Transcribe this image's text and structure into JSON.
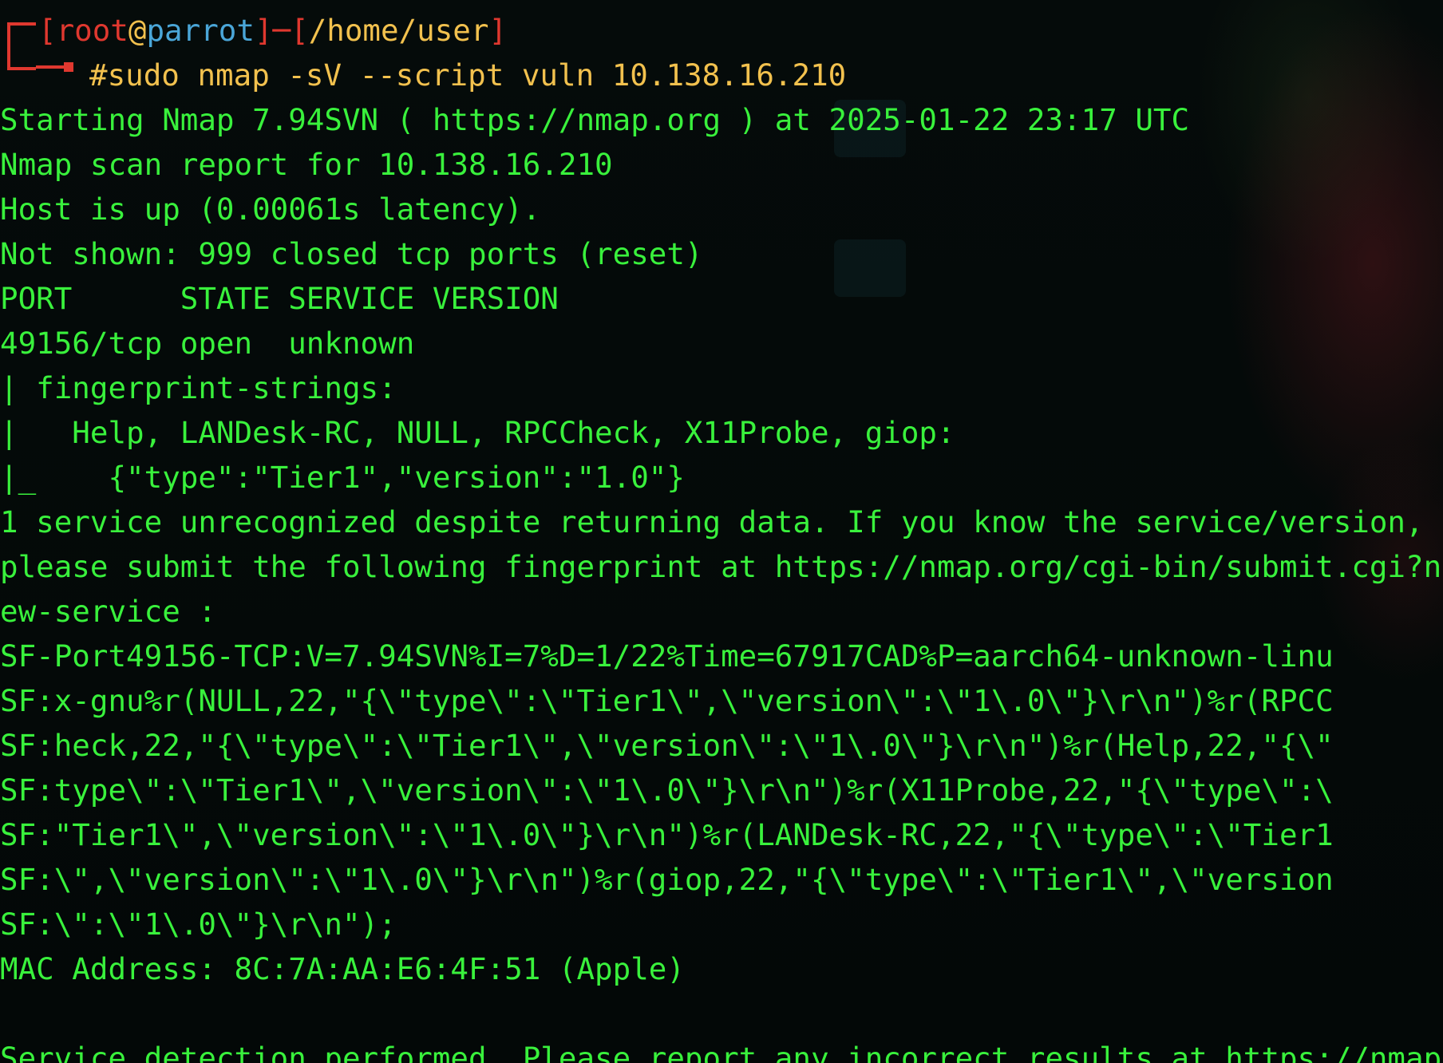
{
  "prompt": {
    "open_bracket": "[",
    "user": "root",
    "at": "@",
    "host": "parrot",
    "separator": "]─[",
    "path": "/home/user",
    "close_bracket": "]",
    "command": "#sudo nmap -sV --script vuln 10.138.16.210"
  },
  "output_lines": [
    "Starting Nmap 7.94SVN ( https://nmap.org ) at 2025-01-22 23:17 UTC",
    "Nmap scan report for 10.138.16.210",
    "Host is up (0.00061s latency).",
    "Not shown: 999 closed tcp ports (reset)",
    "PORT      STATE SERVICE VERSION",
    "49156/tcp open  unknown",
    "| fingerprint-strings:",
    "|   Help, LANDesk-RC, NULL, RPCCheck, X11Probe, giop:",
    "|_    {\"type\":\"Tier1\",\"version\":\"1.0\"}",
    "1 service unrecognized despite returning data. If you know the service/version,",
    "please submit the following fingerprint at https://nmap.org/cgi-bin/submit.cgi?n",
    "ew-service :",
    "SF-Port49156-TCP:V=7.94SVN%I=7%D=1/22%Time=67917CAD%P=aarch64-unknown-linu",
    "SF:x-gnu%r(NULL,22,\"{\\\"type\\\":\\\"Tier1\\\",\\\"version\\\":\\\"1\\.0\\\"}\\r\\n\")%r(RPCC",
    "SF:heck,22,\"{\\\"type\\\":\\\"Tier1\\\",\\\"version\\\":\\\"1\\.0\\\"}\\r\\n\")%r(Help,22,\"{\\\"",
    "SF:type\\\":\\\"Tier1\\\",\\\"version\\\":\\\"1\\.0\\\"}\\r\\n\")%r(X11Probe,22,\"{\\\"type\\\":\\",
    "SF:\"Tier1\\\",\\\"version\\\":\\\"1\\.0\\\"}\\r\\n\")%r(LANDesk-RC,22,\"{\\\"type\\\":\\\"Tier1",
    "SF:\\\",\\\"version\\\":\\\"1\\.0\\\"}\\r\\n\")%r(giop,22,\"{\\\"type\\\":\\\"Tier1\\\",\\\"version",
    "SF:\\\":\\\"1\\.0\\\"}\\r\\n\");",
    "MAC Address: 8C:7A:AA:E6:4F:51 (Apple)",
    "",
    "Service detection performed. Please report any incorrect results at https://nmap"
  ],
  "colors": {
    "output_green": "#39f13c",
    "prompt_red": "#e0382f",
    "prompt_yellow": "#f2c14e",
    "prompt_blue": "#4aa6d8",
    "background": "#040908"
  },
  "icons": {
    "prompt_connector": "prompt-corner-icon"
  }
}
